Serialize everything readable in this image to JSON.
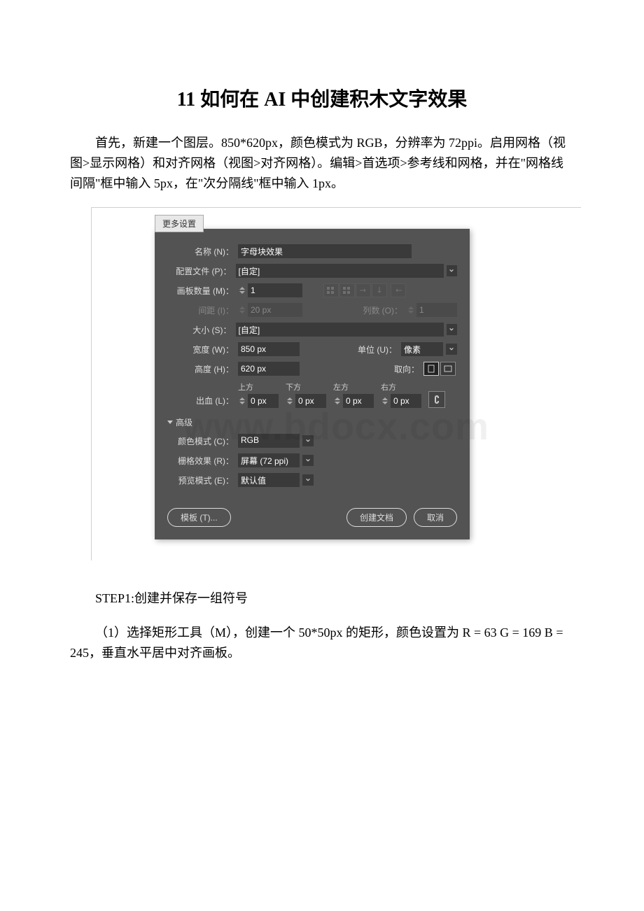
{
  "doc": {
    "title": "11 如何在 AI 中创建积木文字效果",
    "intro": "首先，新建一个图层。850*620px，颜色模式为 RGB，分辨率为 72ppi。启用网格（视图>显示网格）和对齐网格（视图>对齐网格）。编辑>首选项>参考线和网格，并在\"网格线间隔\"框中输入 5px，在\"次分隔线\"框中输入 1px。",
    "step1_label": "STEP1:创建并保存一组符号",
    "step1_body": "（1）选择矩形工具（M），创建一个 50*50px 的矩形，颜色设置为 R = 63 G = 169 B = 245，垂直水平居中对齐画板。"
  },
  "watermark": "www.bdocx.com",
  "dialog": {
    "tab": "更多设置",
    "name_label": "名称 (N)：",
    "name_value": "字母块效果",
    "profile_label": "配置文件 (P)：",
    "profile_value": "[自定]",
    "artboards_label": "画板数量 (M)：",
    "artboards_value": "1",
    "spacing_label": "间距 (I)：",
    "spacing_value": "20 px",
    "columns_label": "列数 (O)：",
    "columns_value": "1",
    "size_label": "大小 (S)：",
    "size_value": "[自定]",
    "width_label": "宽度 (W)：",
    "width_value": "850 px",
    "height_label": "高度 (H)：",
    "height_value": "620 px",
    "units_label": "单位 (U)：",
    "units_value": "像素",
    "orient_label": "取向：",
    "bleed_label": "出血 (L)：",
    "bleed_top": "上方",
    "bleed_bottom": "下方",
    "bleed_left": "左方",
    "bleed_right": "右方",
    "bleed_value": "0 px",
    "advanced": "高级",
    "colormode_label": "颜色模式 (C)：",
    "colormode_value": "RGB",
    "raster_label": "栅格效果 (R)：",
    "raster_value": "屏幕 (72 ppi)",
    "preview_label": "预览模式 (E)：",
    "preview_value": "默认值",
    "templates_btn": "模板 (T)...",
    "create_btn": "创建文档",
    "cancel_btn": "取消"
  }
}
